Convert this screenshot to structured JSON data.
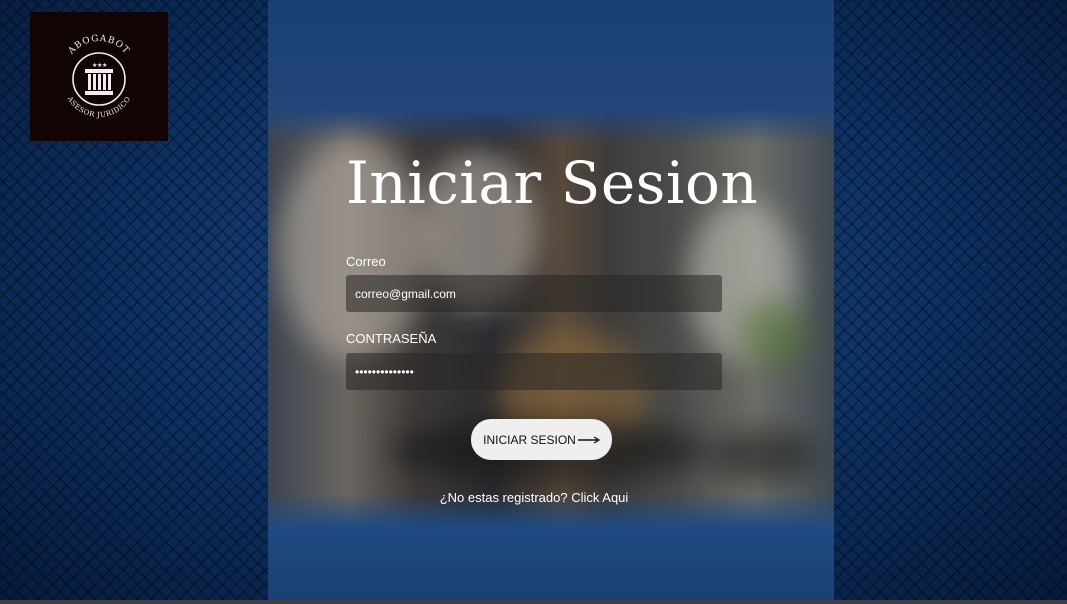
{
  "logo": {
    "top_text": "ABOGABOT",
    "bottom_text": "ASESOR JURIDICO",
    "icon": "column-pillar-icon"
  },
  "form": {
    "title": "Iniciar Sesion",
    "email_label": "Correo",
    "email_value": "correo@gmail.com",
    "password_label": "CONTRASEÑA",
    "password_value": "••••••••••••••",
    "submit_label": "INICIAR SESION",
    "submit_icon": "arrow-right-icon",
    "register_link": "¿No estas registrado? Click Aqui"
  },
  "colors": {
    "background": "#0d3061",
    "logo_bg": "#120404",
    "button_bg": "#efefef",
    "text": "#ffffff"
  }
}
